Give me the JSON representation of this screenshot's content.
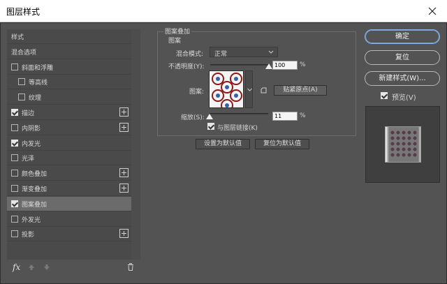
{
  "window": {
    "title": "图层样式"
  },
  "style_list": {
    "items": [
      {
        "label": "样式",
        "checkbox": false,
        "checked": false,
        "plus": false,
        "selected": false,
        "indent": false
      },
      {
        "label": "混合选项",
        "checkbox": false,
        "checked": false,
        "plus": false,
        "selected": false,
        "indent": false
      },
      {
        "label": "斜面和浮雕",
        "checkbox": true,
        "checked": false,
        "plus": false,
        "selected": false,
        "indent": false
      },
      {
        "label": "等高线",
        "checkbox": true,
        "checked": false,
        "plus": false,
        "selected": false,
        "indent": true
      },
      {
        "label": "纹理",
        "checkbox": true,
        "checked": false,
        "plus": false,
        "selected": false,
        "indent": true
      },
      {
        "label": "描边",
        "checkbox": true,
        "checked": true,
        "plus": true,
        "selected": false,
        "indent": false
      },
      {
        "label": "内阴影",
        "checkbox": true,
        "checked": false,
        "plus": true,
        "selected": false,
        "indent": false
      },
      {
        "label": "内发光",
        "checkbox": true,
        "checked": true,
        "plus": false,
        "selected": false,
        "indent": false
      },
      {
        "label": "光泽",
        "checkbox": true,
        "checked": false,
        "plus": false,
        "selected": false,
        "indent": false
      },
      {
        "label": "颜色叠加",
        "checkbox": true,
        "checked": false,
        "plus": true,
        "selected": false,
        "indent": false
      },
      {
        "label": "渐变叠加",
        "checkbox": true,
        "checked": false,
        "plus": true,
        "selected": false,
        "indent": false
      },
      {
        "label": "图案叠加",
        "checkbox": true,
        "checked": true,
        "plus": false,
        "selected": true,
        "indent": false
      },
      {
        "label": "外发光",
        "checkbox": true,
        "checked": false,
        "plus": false,
        "selected": false,
        "indent": false
      },
      {
        "label": "投影",
        "checkbox": true,
        "checked": false,
        "plus": true,
        "selected": false,
        "indent": false
      }
    ],
    "footer": {
      "fx_label": "fx"
    }
  },
  "panel": {
    "group_title": "图案叠加",
    "subgroup_title": "图案",
    "blend_mode_label": "混合模式:",
    "blend_mode_value": "正常",
    "opacity_label": "不透明度(Y):",
    "opacity_value": "100",
    "opacity_unit": "%",
    "opacity_fraction": 1.0,
    "pattern_label": "图案:",
    "snap_origin_button": "贴紧原点(A)",
    "scale_label": "缩放(S):",
    "scale_value": "11",
    "scale_unit": "%",
    "scale_fraction": 0.0,
    "link_with_layer_label": "与图层链接(K)",
    "link_with_layer_checked": true,
    "make_default_button": "设置为默认值",
    "reset_default_button": "复位为默认值"
  },
  "actions": {
    "ok": "确定",
    "reset": "复位",
    "new_style": "新建样式(W)...",
    "preview_label": "预览(V)",
    "preview_checked": true
  },
  "colors": {
    "dialog_bg": "#535353",
    "list_bg": "#4a4a4a",
    "selected_row": "#6b6b6b",
    "primary_border": "#8ab4e8"
  }
}
